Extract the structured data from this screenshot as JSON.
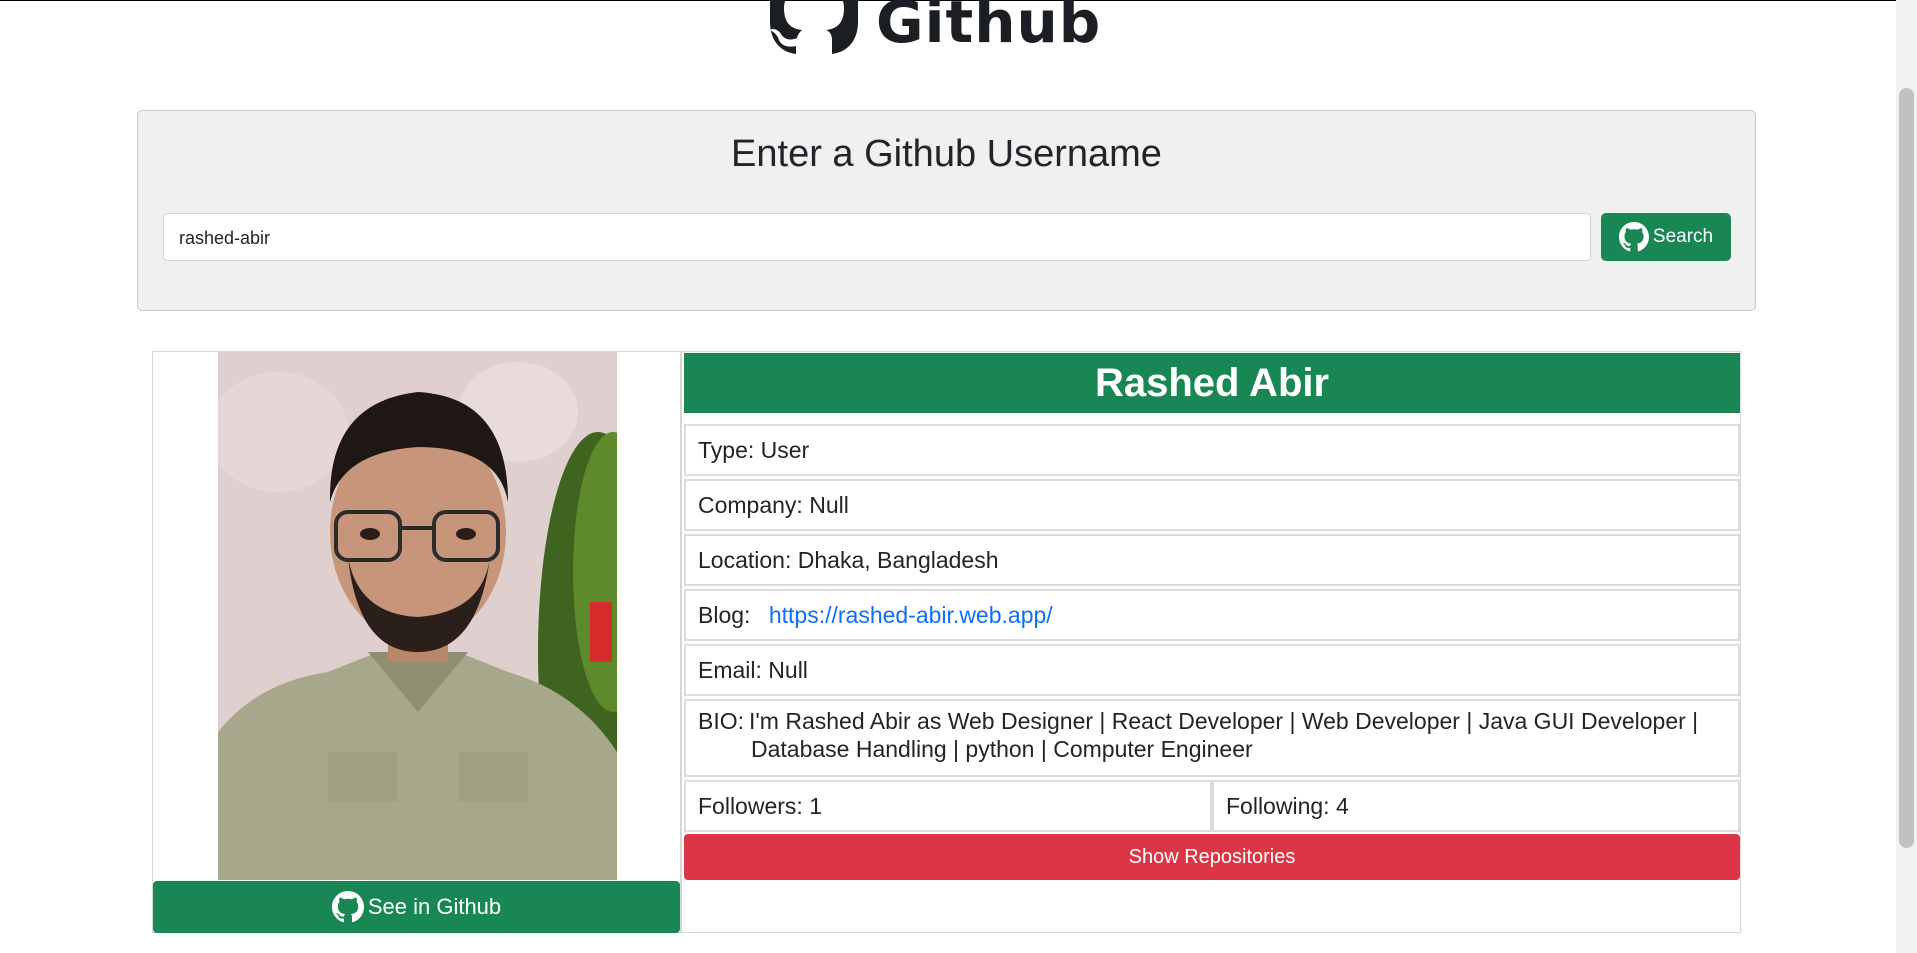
{
  "header": {
    "logo_text": "Github"
  },
  "search": {
    "title": "Enter a Github Username",
    "input_value": "rashed-abir",
    "button_label": "Search"
  },
  "profile": {
    "name": "Rashed Abir",
    "see_github_label": "See in Github",
    "type_label": "Type: ",
    "type_value": "User",
    "company_label": "Company: ",
    "company_value": "Null",
    "location_label": "Location: ",
    "location_value": "Dhaka, Bangladesh",
    "blog_label": "Blog: ",
    "blog_value": "https://rashed-abir.web.app/",
    "email_label": "Email: ",
    "email_value": "Null",
    "bio_label": "BIO:",
    "bio_value": "I'm Rashed Abir as Web Designer | React Developer | Web Developer | Java GUI Developer | Database Handling | python | Computer Engineer",
    "followers_label": "Followers: ",
    "followers_value": "1",
    "following_label": "Following: ",
    "following_value": "4",
    "repos_button_label": "Show Repositories"
  },
  "colors": {
    "accent_green": "#198754",
    "danger_red": "#dc3545",
    "link_blue": "#0d6efd"
  }
}
